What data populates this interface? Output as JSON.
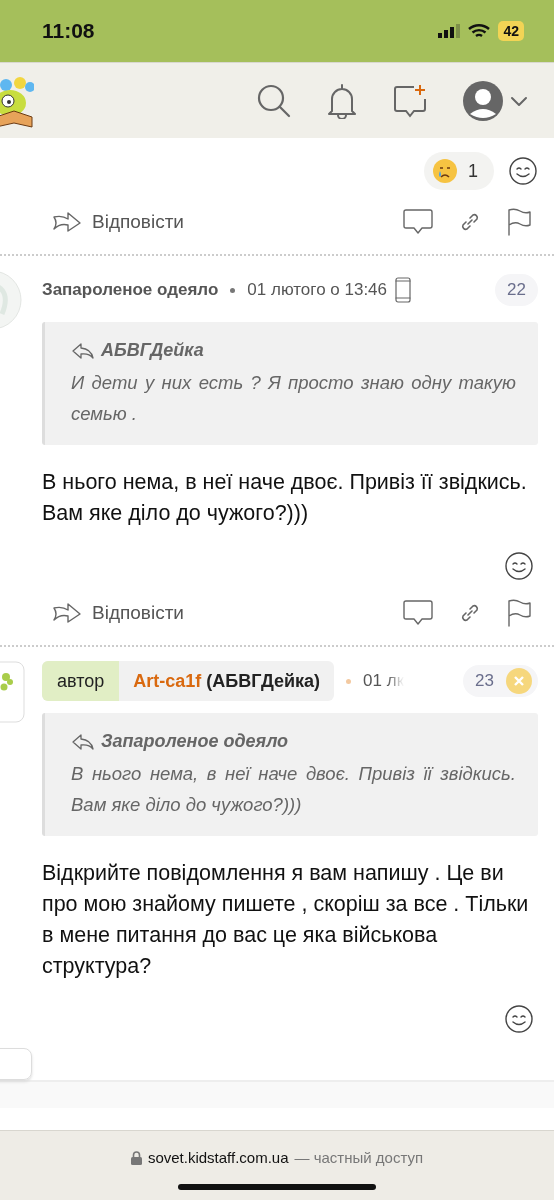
{
  "status_bar": {
    "time": "11:08",
    "battery": "42"
  },
  "posts": [
    {
      "kind": "tail",
      "reactions": [
        {
          "count": "1"
        }
      ],
      "reply_label": "Відповісти"
    },
    {
      "kind": "post",
      "avatar": {
        "kind": "circle"
      },
      "author": "Запароленое одеяло",
      "date": "01 лютого о 13:46",
      "number": "22",
      "quote": {
        "author": "АБВГДейка",
        "text": "И дети у них есть ? Я просто знаю одну такую семью ."
      },
      "body": "В нього нема, в неї наче двоє. Привіз її звідкись. Вам яке діло до чужого?)))",
      "reply_label": "Відповісти"
    },
    {
      "kind": "post",
      "avatar": {
        "kind": "square"
      },
      "author_badge": "автор",
      "author": "Art-ca1f",
      "author_suffix": "(АБВГДейка)",
      "date": "01 лк",
      "number": "23",
      "quote": {
        "author": "Запароленое одеяло",
        "text": "В нього нема, в неї наче двоє. Привіз її звідкись. Вам яке діло до чужого?)))"
      },
      "body": "Відкрийте повідомлення я вам напишу . Це ви про мою знайому пишете , скоріш за все . Тільки в мене питання до вас це яка військова структура?"
    }
  ],
  "browser_bar": {
    "url": "sovet.kidstaff.com.ua",
    "suffix": "— частный доступ"
  }
}
